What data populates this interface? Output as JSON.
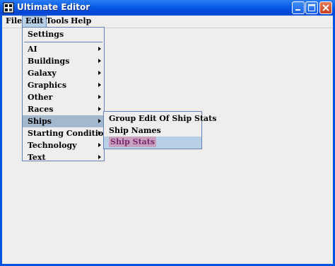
{
  "window": {
    "title": "Ultimate Editor"
  },
  "menubar": {
    "items": [
      {
        "label": "File"
      },
      {
        "label": "Edit"
      },
      {
        "label": "Tools"
      },
      {
        "label": "Help"
      }
    ]
  },
  "edit_menu": {
    "settings": "Settings",
    "items": [
      {
        "label": "AI",
        "submenu": true
      },
      {
        "label": "Buildings",
        "submenu": true
      },
      {
        "label": "Galaxy",
        "submenu": true
      },
      {
        "label": "Graphics",
        "submenu": true
      },
      {
        "label": "Other",
        "submenu": true
      },
      {
        "label": "Races",
        "submenu": true
      },
      {
        "label": "Ships",
        "submenu": true
      },
      {
        "label": "Starting Conditions",
        "submenu": true
      },
      {
        "label": "Technology",
        "submenu": true
      },
      {
        "label": "Text",
        "submenu": true
      }
    ]
  },
  "ships_menu": {
    "items": [
      {
        "label": "Group Edit Of Ship Stats"
      },
      {
        "label": "Ship Names"
      },
      {
        "label": "Ship Stats"
      }
    ]
  },
  "icons": {
    "app": "app-icon",
    "minimize": "minimize-icon",
    "maximize": "maximize-icon",
    "close": "close-icon",
    "submenu": "chevron-right-icon"
  }
}
